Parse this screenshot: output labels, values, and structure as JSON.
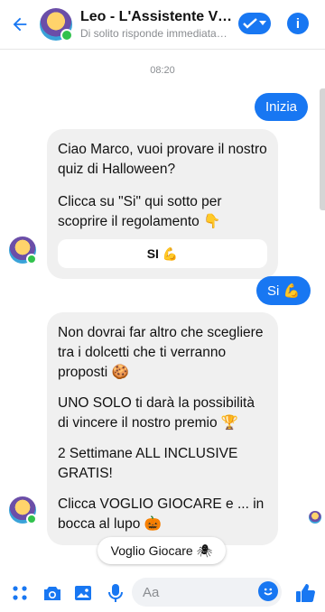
{
  "header": {
    "title": "Leo - L'Assistente Virtuale",
    "subtitle": "Di solito risponde immediatamente",
    "back_icon": "arrow-left-icon",
    "check_icon": "check-icon",
    "info_label": "i",
    "accent": "#1877f2"
  },
  "timestamp": "08:20",
  "messages": {
    "out1": "Inizia",
    "in1_lines": [
      "Ciao Marco, vuoi provare il nostro quiz di Halloween?",
      "",
      "Clicca su \"Si\" qui sotto per scoprire il regolamento 👇"
    ],
    "in1_button": "SI 💪",
    "out2": "Si 💪",
    "in2_lines": [
      "Non dovrai far altro che scegliere tra i dolcetti che ti verranno proposti 🍪",
      "",
      "UNO SOLO ti darà la possibilità di vincere il nostro premio 🏆",
      "",
      "2 Settimane ALL INCLUSIVE GRATIS!",
      "",
      "Clicca VOGLIO GIOCARE e ... in bocca al lupo 🎃"
    ]
  },
  "quick_reply": "Voglio Giocare 🕷",
  "composer": {
    "placeholder": "Aa",
    "icons": [
      "apps-icon",
      "camera-icon",
      "gallery-icon",
      "mic-icon",
      "emoji-icon",
      "thumbs-up-icon"
    ]
  }
}
